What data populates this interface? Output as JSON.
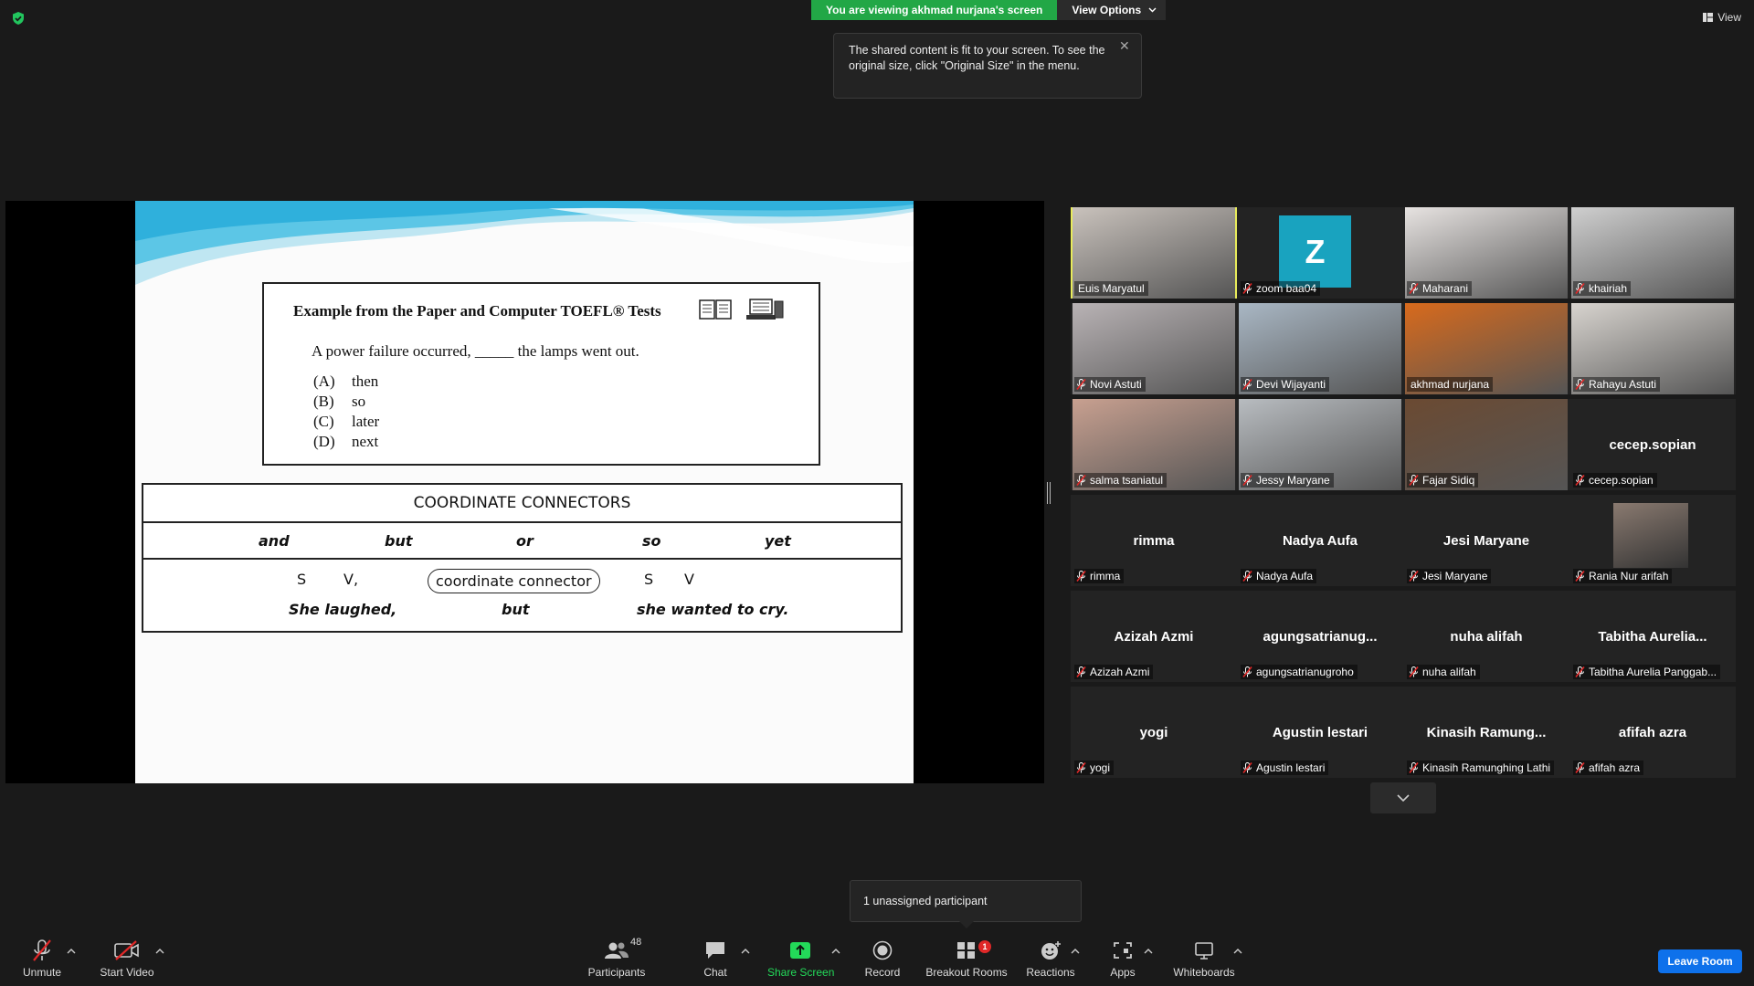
{
  "top": {
    "banner_text": "You are viewing akhmad nurjana's screen",
    "view_options_label": "View Options",
    "view_label": "View"
  },
  "tooltip": {
    "text": "The shared content is fit to your screen. To see the original size, click \"Original Size\" in the menu."
  },
  "slide": {
    "box_title": "Example from the Paper and Computer TOEFL® Tests",
    "question": "A power failure occurred, _____ the lamps went out.",
    "options": [
      {
        "letter": "(A)",
        "text": "then"
      },
      {
        "letter": "(B)",
        "text": "so"
      },
      {
        "letter": "(C)",
        "text": "later"
      },
      {
        "letter": "(D)",
        "text": "next"
      }
    ],
    "table_title": "COORDINATE CONNECTORS",
    "connectors": [
      "and",
      "but",
      "or",
      "so",
      "yet"
    ],
    "pattern": {
      "s1": "S",
      "v1": "V,",
      "connector": "coordinate connector",
      "s2": "S",
      "v2": "V"
    },
    "example": {
      "part1": "She laughed,",
      "conn": "but",
      "part2": "she wanted to cry."
    }
  },
  "participants": [
    {
      "name": "Euis Maryatul",
      "display": "",
      "type": "photo",
      "active": true,
      "muted": false,
      "color": "#c9c2bc"
    },
    {
      "name": "zoom baa04",
      "display": "",
      "type": "avatar",
      "initial": "Z",
      "muted": true
    },
    {
      "name": "Maharani",
      "display": "",
      "type": "photo",
      "muted": true,
      "color": "#e7e3e1"
    },
    {
      "name": "khairiah",
      "display": "",
      "type": "photo",
      "muted": true,
      "color": "#cfcfcf"
    },
    {
      "name": "Novi Astuti",
      "display": "",
      "type": "photo",
      "muted": true,
      "color": "#b9b3b5"
    },
    {
      "name": "Devi Wijayanti",
      "display": "",
      "type": "photo",
      "muted": true,
      "color": "#a9b7c4"
    },
    {
      "name": "akhmad nurjana",
      "display": "",
      "type": "photo",
      "muted": false,
      "color": "#d86a1c"
    },
    {
      "name": "Rahayu Astuti",
      "display": "",
      "type": "photo",
      "muted": true,
      "color": "#d8d4cf"
    },
    {
      "name": "salma tsaniatul",
      "display": "",
      "type": "photo",
      "muted": true,
      "color": "#c8a090"
    },
    {
      "name": "Jessy Maryane",
      "display": "",
      "type": "photo",
      "muted": true,
      "color": "#b8bcc0"
    },
    {
      "name": "Fajar Sidiq",
      "display": "",
      "type": "photo",
      "muted": true,
      "color": "#6b4a32"
    },
    {
      "name": "cecep.sopian",
      "display": "cecep.sopian",
      "type": "name",
      "muted": true
    },
    {
      "name": "rimma",
      "display": "rimma",
      "type": "name",
      "muted": true
    },
    {
      "name": "Nadya Aufa",
      "display": "Nadya Aufa",
      "type": "name",
      "muted": true
    },
    {
      "name": "Jesi Maryane",
      "display": "Jesi Maryane",
      "type": "name",
      "muted": true
    },
    {
      "name": "Rania Nur arifah",
      "display": "",
      "type": "photo-small",
      "muted": true,
      "color": "#8a7a70"
    },
    {
      "name": "Azizah Azmi",
      "display": "Azizah Azmi",
      "type": "name",
      "muted": true
    },
    {
      "name": "agungsatrianugroho",
      "display": "agungsatrianug...",
      "type": "name",
      "muted": true
    },
    {
      "name": "nuha alifah",
      "display": "nuha alifah",
      "type": "name",
      "muted": true
    },
    {
      "name": "Tabitha Aurelia Panggab...",
      "display": "Tabitha  Aurelia...",
      "type": "name",
      "muted": true
    },
    {
      "name": "yogi",
      "display": "yogi",
      "type": "name",
      "muted": true
    },
    {
      "name": "Agustin lestari",
      "display": "Agustin lestari",
      "type": "name",
      "muted": true
    },
    {
      "name": "Kinasih Ramunghing Lathi",
      "display": "Kinasih  Ramung...",
      "type": "name",
      "muted": true
    },
    {
      "name": "afifah azra",
      "display": "afifah azra",
      "type": "name",
      "muted": true
    }
  ],
  "unassigned": "1 unassigned participant",
  "toolbar": {
    "unmute": "Unmute",
    "start_video": "Start Video",
    "participants": "Participants",
    "participants_count": "48",
    "chat": "Chat",
    "share_screen": "Share Screen",
    "record": "Record",
    "breakout_rooms": "Breakout Rooms",
    "breakout_badge": "1",
    "reactions": "Reactions",
    "apps": "Apps",
    "whiteboards": "Whiteboards",
    "leave": "Leave Room"
  },
  "colors": {
    "banner_green": "#22a746",
    "share_green": "#23d959",
    "active_speaker": "#e9ec5a",
    "leave_blue": "#0e71eb",
    "muted_red": "#e02828"
  }
}
